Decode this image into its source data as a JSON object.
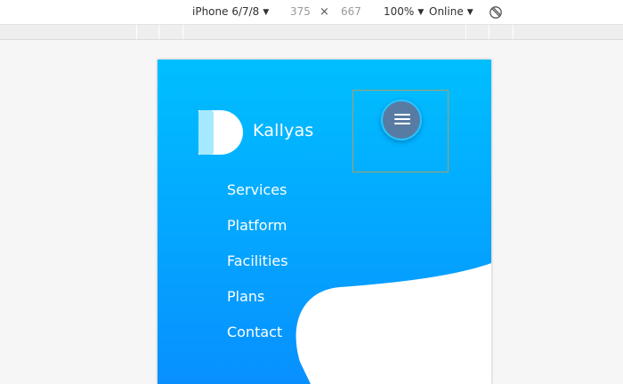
{
  "devtools": {
    "device": "iPhone 6/7/8",
    "width": "375",
    "times": "×",
    "height": "667",
    "zoom": "100%",
    "network": "Online",
    "rotate_icon": "rotate-icon"
  },
  "site": {
    "brand": "Kallyas",
    "logo_icon": "kallyas-logo-icon",
    "menu_icon": "hamburger-menu-icon",
    "nav": [
      "Services",
      "Platform",
      "Facilities",
      "Plans",
      "Contact"
    ],
    "colors": {
      "gradient_top": "#00bfff",
      "gradient_bottom": "#0890ff",
      "menu_button": "#587ba3",
      "menu_ring": "#29c5ff",
      "wave": "#ffffff"
    }
  }
}
